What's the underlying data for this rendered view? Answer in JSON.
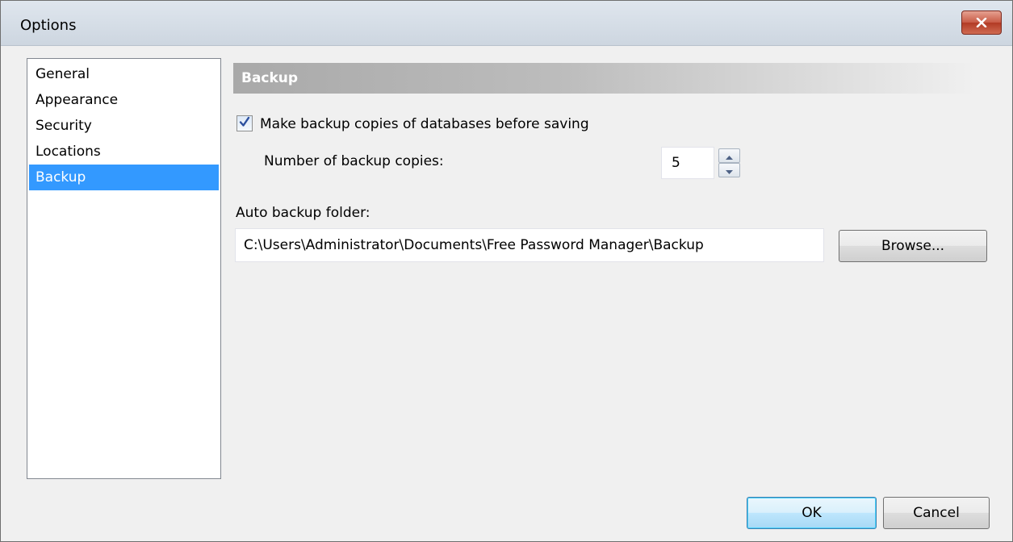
{
  "window": {
    "title": "Options"
  },
  "nav": {
    "items": [
      {
        "label": "General"
      },
      {
        "label": "Appearance"
      },
      {
        "label": "Security"
      },
      {
        "label": "Locations"
      },
      {
        "label": "Backup"
      }
    ],
    "selected": "Backup"
  },
  "section": {
    "title": "Backup"
  },
  "backup": {
    "make_copies_label": "Make backup copies of databases before saving",
    "make_copies_checked": true,
    "copies_label": "Number of backup copies:",
    "copies_value": "5",
    "folder_label": "Auto backup folder:",
    "folder_value": "C:\\Users\\Administrator\\Documents\\Free Password Manager\\Backup",
    "browse_label": "Browse..."
  },
  "footer": {
    "ok_label": "OK",
    "cancel_label": "Cancel"
  },
  "icons": {
    "close": "close-icon",
    "check": "checkmark-icon",
    "spin_up": "arrow-up-icon",
    "spin_down": "arrow-down-icon"
  },
  "colors": {
    "selection": "#3399ff",
    "close_button": "#c85a45",
    "default_button_border": "#3c7fb1"
  }
}
